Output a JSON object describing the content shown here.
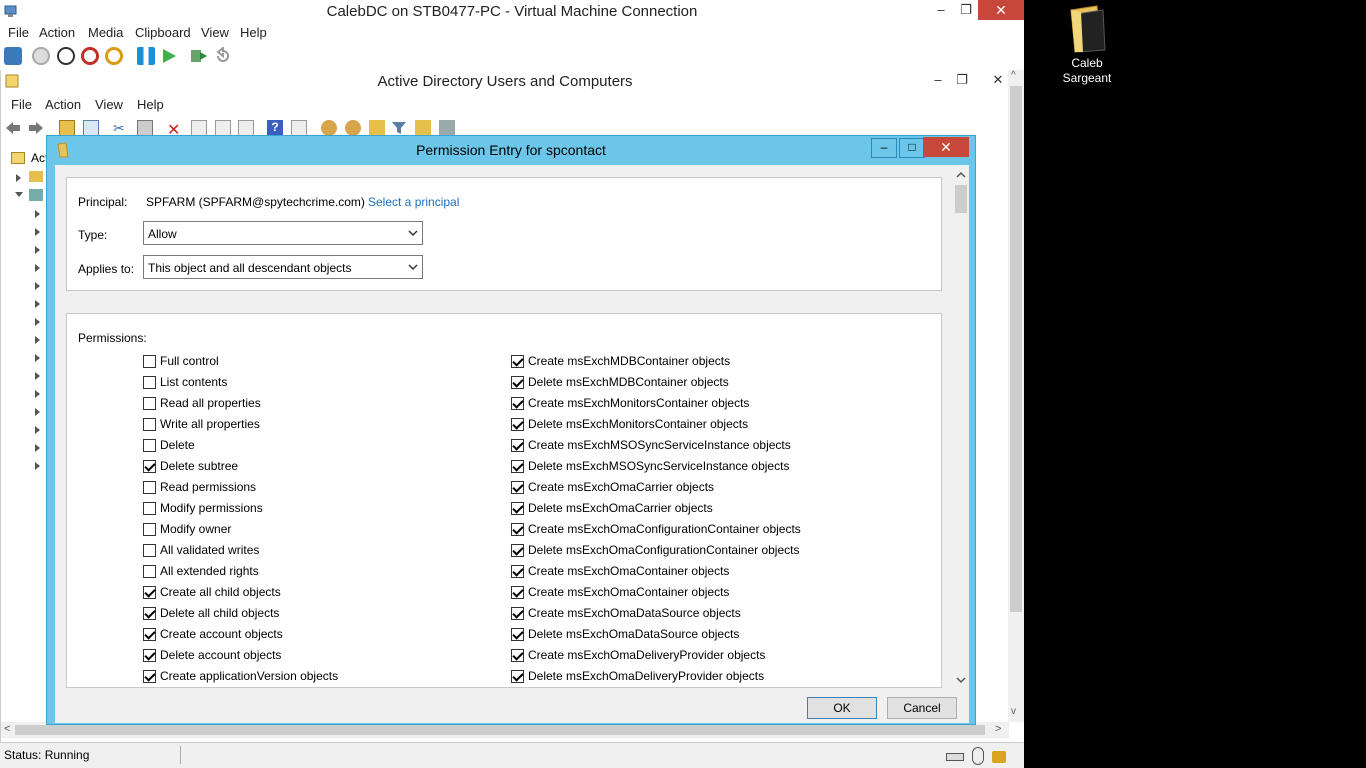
{
  "desktop": {
    "icon_label_line1": "Caleb",
    "icon_label_line2": "Sargeant"
  },
  "vm": {
    "title": "CalebDC on STB0477-PC - Virtual Machine Connection",
    "menu": [
      "File",
      "Action",
      "Media",
      "Clipboard",
      "View",
      "Help"
    ],
    "status": "Status: Running"
  },
  "aduc": {
    "title": "Active Directory Users and Computers",
    "menu": [
      "File",
      "Action",
      "View",
      "Help"
    ],
    "tree_root_label": "Act"
  },
  "dialog": {
    "title": "Permission Entry for spcontact",
    "principal_label": "Principal:",
    "principal_value": "SPFARM (SPFARM@spytechcrime.com)",
    "select_principal_link": "Select a principal",
    "type_label": "Type:",
    "type_value": "Allow",
    "applies_label": "Applies to:",
    "applies_value": "This object and all descendant objects",
    "permissions_label": "Permissions:",
    "ok_label": "OK",
    "cancel_label": "Cancel",
    "left_permissions": [
      {
        "label": "Full control",
        "checked": false
      },
      {
        "label": "List contents",
        "checked": false
      },
      {
        "label": "Read all properties",
        "checked": false
      },
      {
        "label": "Write all properties",
        "checked": false
      },
      {
        "label": "Delete",
        "checked": false
      },
      {
        "label": "Delete subtree",
        "checked": true
      },
      {
        "label": "Read permissions",
        "checked": false
      },
      {
        "label": "Modify permissions",
        "checked": false
      },
      {
        "label": "Modify owner",
        "checked": false
      },
      {
        "label": "All validated writes",
        "checked": false
      },
      {
        "label": "All extended rights",
        "checked": false
      },
      {
        "label": "Create all child objects",
        "checked": true
      },
      {
        "label": "Delete all child objects",
        "checked": true
      },
      {
        "label": "Create account objects",
        "checked": true
      },
      {
        "label": "Delete account objects",
        "checked": true
      },
      {
        "label": "Create applicationVersion objects",
        "checked": true
      }
    ],
    "right_permissions": [
      {
        "label": "Create msExchMDBContainer objects",
        "checked": true
      },
      {
        "label": "Delete msExchMDBContainer objects",
        "checked": true
      },
      {
        "label": "Create msExchMonitorsContainer objects",
        "checked": true
      },
      {
        "label": "Delete msExchMonitorsContainer objects",
        "checked": true
      },
      {
        "label": "Create msExchMSOSyncServiceInstance objects",
        "checked": true
      },
      {
        "label": "Delete msExchMSOSyncServiceInstance objects",
        "checked": true
      },
      {
        "label": "Create msExchOmaCarrier objects",
        "checked": true
      },
      {
        "label": "Delete msExchOmaCarrier objects",
        "checked": true
      },
      {
        "label": "Create msExchOmaConfigurationContainer objects",
        "checked": true
      },
      {
        "label": "Delete msExchOmaConfigurationContainer objects",
        "checked": true
      },
      {
        "label": "Create msExchOmaContainer objects",
        "checked": true
      },
      {
        "label": "Create msExchOmaContainer objects",
        "checked": true
      },
      {
        "label": "Create msExchOmaDataSource objects",
        "checked": true
      },
      {
        "label": "Delete msExchOmaDataSource objects",
        "checked": true
      },
      {
        "label": "Create msExchOmaDeliveryProvider objects",
        "checked": true
      },
      {
        "label": "Delete msExchOmaDeliveryProvider objects",
        "checked": true
      }
    ]
  }
}
